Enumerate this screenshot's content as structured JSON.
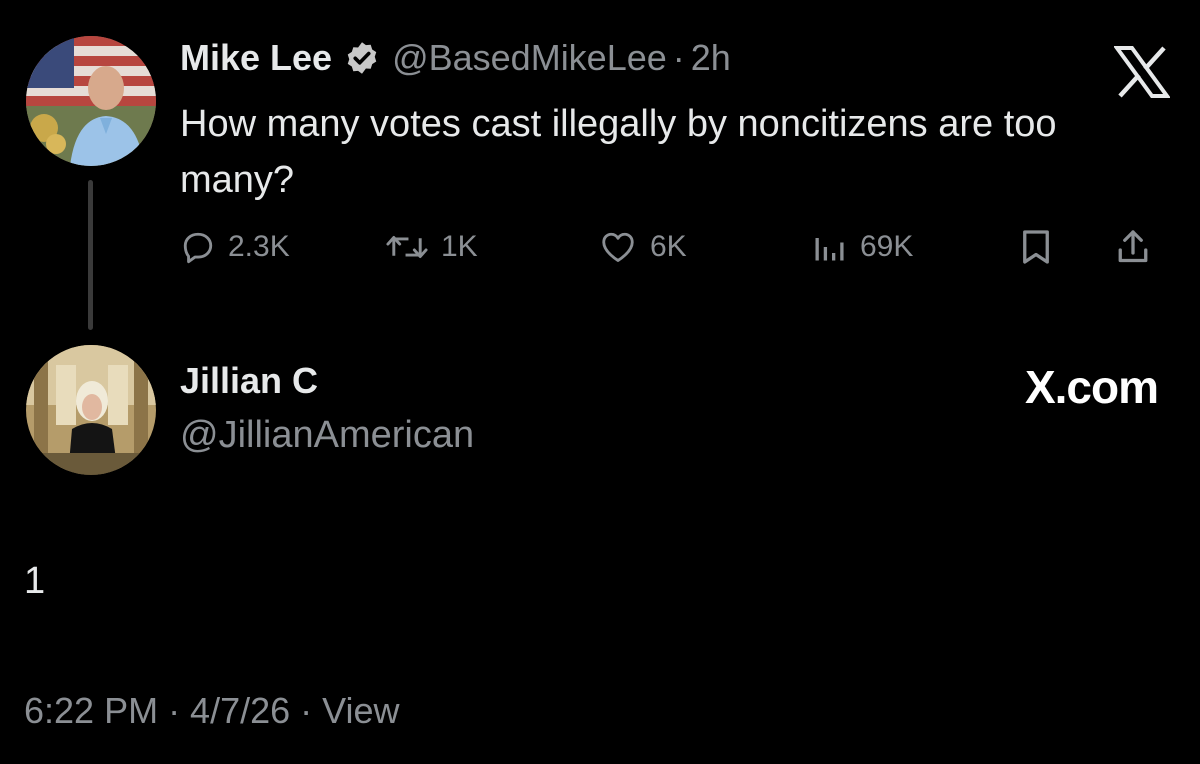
{
  "tweet": {
    "author": {
      "display_name": "Mike Lee",
      "verified": true,
      "handle": "@BasedMikeLee",
      "separator": "·",
      "time_ago": "2h"
    },
    "text": "How many votes cast illegally by noncitizens are too many?",
    "stats": {
      "replies": "2.3K",
      "retweets": "1K",
      "likes": "6K",
      "views": "69K"
    }
  },
  "reply": {
    "author": {
      "display_name": "Jillian C",
      "handle": "@JillianAmerican"
    },
    "watermark": "X.com",
    "text": "1",
    "footer": "6:22 PM · 4/7/26 · View"
  },
  "icons": {
    "brand": "x-logo-icon",
    "verified": "verified-badge-icon",
    "reply": "comment-bubble-icon",
    "retweet": "retweet-icon",
    "like": "heart-icon",
    "views": "bar-chart-icon",
    "bookmark": "bookmark-icon",
    "share": "share-upload-icon"
  },
  "colors": {
    "background": "#000000",
    "primary_text": "#e7e9ea",
    "secondary_text": "#8b8f94",
    "verified_badge": "#c8c8c8"
  }
}
